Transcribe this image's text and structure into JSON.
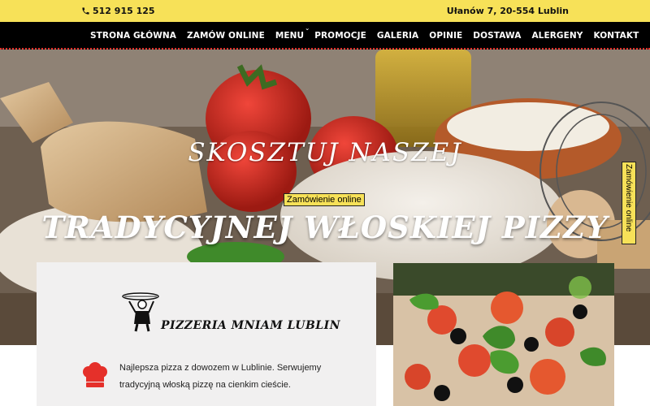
{
  "topbar": {
    "phone": "512 915 125",
    "address": "Ułanów 7, 20-554 Lublin"
  },
  "nav": {
    "items": [
      {
        "label": "STRONA GŁÓWNA"
      },
      {
        "label": "ZAMÓW ONLINE"
      },
      {
        "label": "MENU",
        "has_dropdown": true
      },
      {
        "label": "PROMOCJE"
      },
      {
        "label": "GALERIA"
      },
      {
        "label": "OPINIE"
      },
      {
        "label": "DOSTAWA"
      },
      {
        "label": "ALERGENY"
      },
      {
        "label": "KONTAKT"
      }
    ]
  },
  "hero": {
    "headline_1": "SKOSZTUJ NASZEJ",
    "headline_2": "TRADYCYJNEJ WŁOSKIEJ PIZZY",
    "order_button": "Zamówienie online"
  },
  "side_button": {
    "label": "Zamówienie online"
  },
  "card": {
    "logo_text": "PIZZERIA MNIAM LUBLIN",
    "description": "Najlepsza pizza z dowozem w Lublinie. Serwujemy tradycyjną włoską pizzę na cienkim cieście."
  },
  "colors": {
    "accent_yellow": "#f7e158",
    "nav_black": "#000000",
    "chef_hat_red": "#e5302a"
  }
}
